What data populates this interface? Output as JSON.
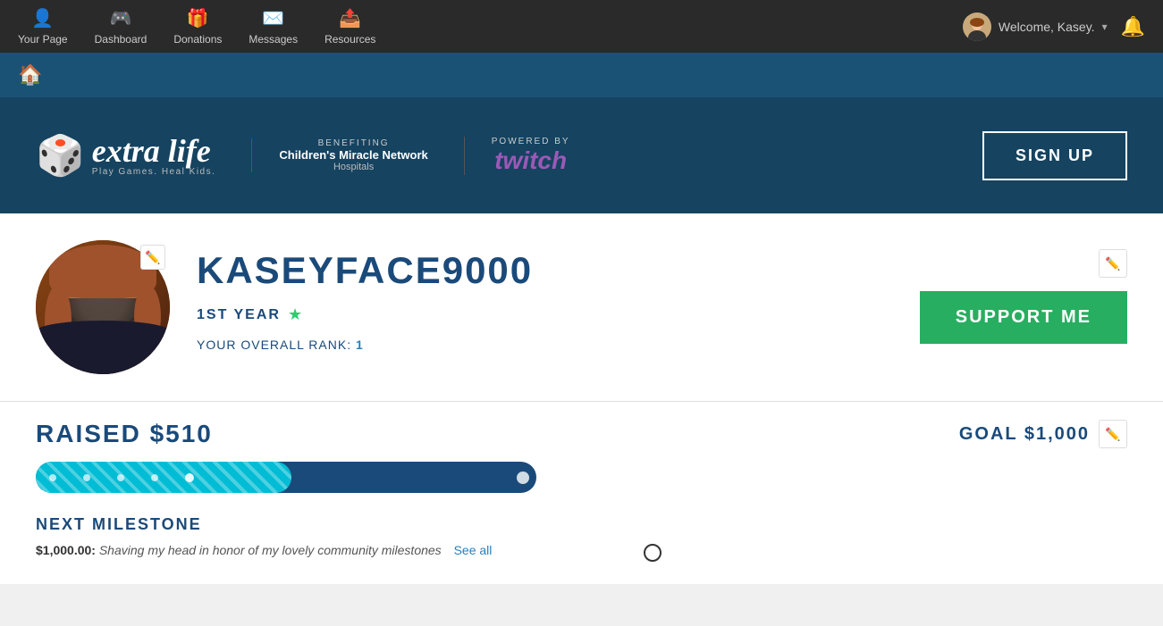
{
  "nav": {
    "items": [
      {
        "id": "your-page",
        "label": "Your Page",
        "icon": "👤"
      },
      {
        "id": "dashboard",
        "label": "Dashboard",
        "icon": "🎮"
      },
      {
        "id": "donations",
        "label": "Donations",
        "icon": "🎁"
      },
      {
        "id": "messages",
        "label": "Messages",
        "icon": "✉️"
      },
      {
        "id": "resources",
        "label": "Resources",
        "icon": "📤"
      }
    ],
    "user_greeting": "Welcome, Kasey.",
    "dropdown_arrow": "▾"
  },
  "brand": {
    "extra_life": {
      "name": "extra life",
      "tagline": "Play Games. Heal Kids.",
      "tm": "™"
    },
    "benefiting": {
      "label": "BENEFITING",
      "org": "Children's Miracle Network",
      "org_sub": "Hospitals"
    },
    "powered": {
      "label": "POWERED BY",
      "platform": "twitch"
    },
    "signup_label": "SIGN UP"
  },
  "profile": {
    "username": "KASEYFACE9000",
    "year": "1ST YEAR",
    "rank_label": "YOUR OVERALL RANK:",
    "rank_value": "1",
    "edit_icon": "✏️",
    "support_label": "SUPPORT ME"
  },
  "fundraising": {
    "raised_label": "RAISED $510",
    "goal_label": "GOAL $1,000",
    "edit_icon": "✏️",
    "progress_percent": 51,
    "milestone": {
      "title": "NEXT MILESTONE",
      "amount": "$1,000.00:",
      "description": "Shaving my head in honor of my lovely community milestones",
      "see_all_label": "See all"
    }
  }
}
